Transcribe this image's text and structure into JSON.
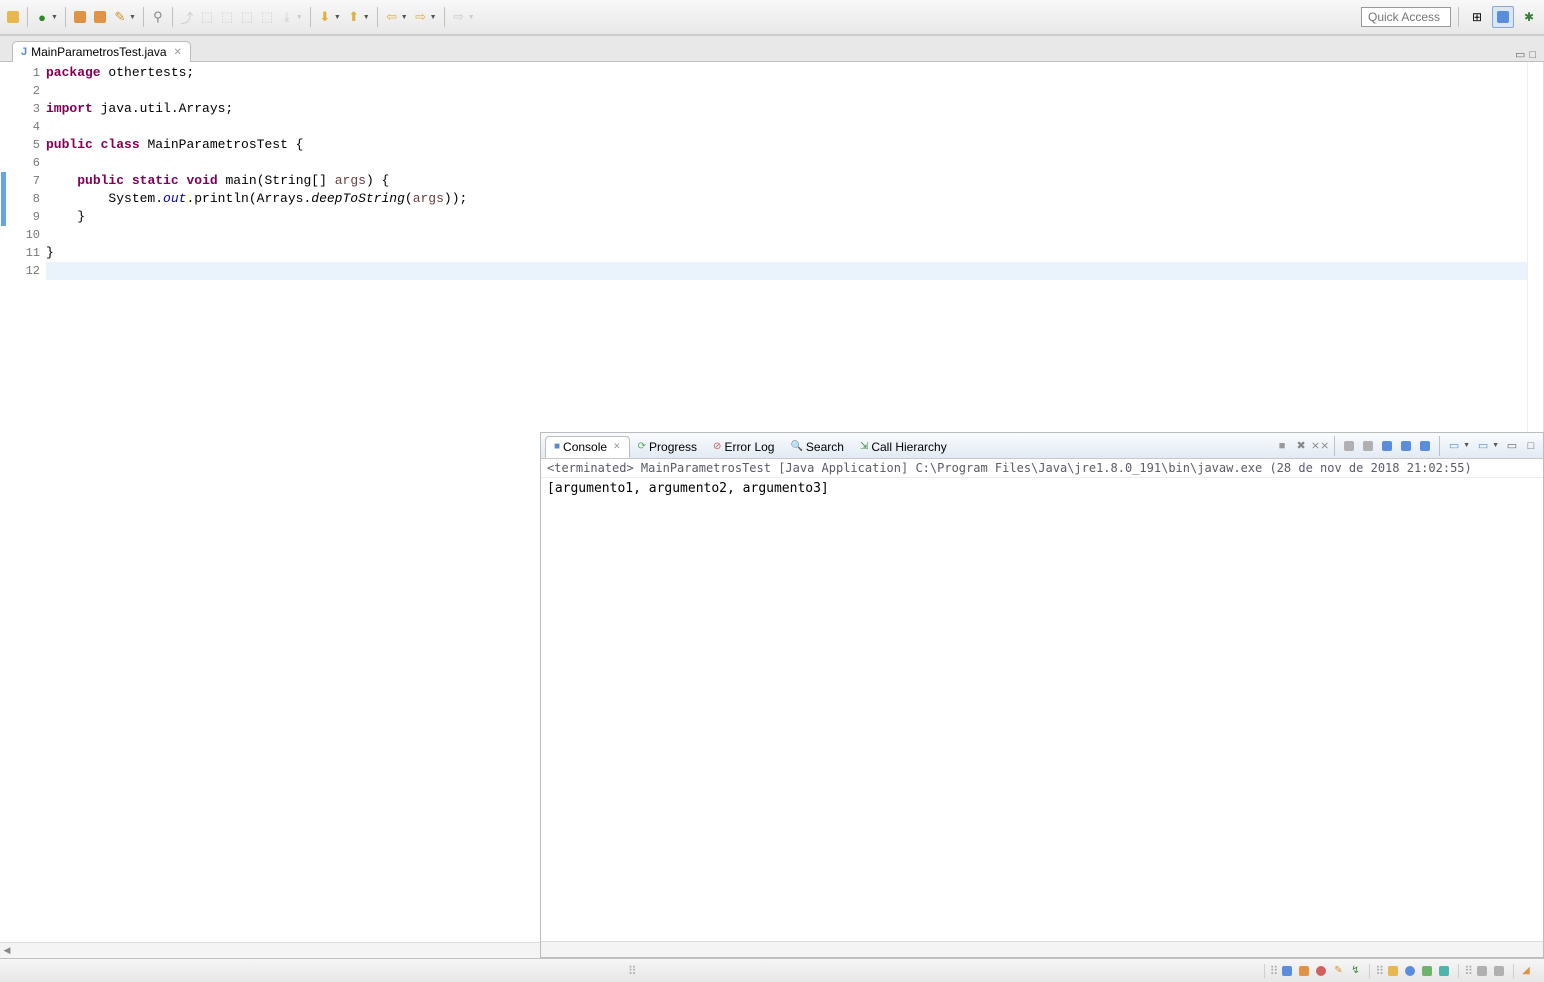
{
  "toolbar": {
    "quick_access_placeholder": "Quick Access"
  },
  "editor": {
    "tab_filename": "MainParametrosTest.java",
    "code_lines": [
      {
        "n": 1,
        "seg": [
          [
            "kw",
            "package"
          ],
          [
            "txt",
            " othertests;"
          ]
        ]
      },
      {
        "n": 2,
        "seg": [
          [
            "txt",
            ""
          ]
        ]
      },
      {
        "n": 3,
        "seg": [
          [
            "kw",
            "import"
          ],
          [
            "txt",
            " java.util.Arrays;"
          ]
        ]
      },
      {
        "n": 4,
        "seg": [
          [
            "txt",
            ""
          ]
        ]
      },
      {
        "n": 5,
        "seg": [
          [
            "kw",
            "public"
          ],
          [
            "txt",
            " "
          ],
          [
            "kw",
            "class"
          ],
          [
            "txt",
            " MainParametrosTest {"
          ]
        ]
      },
      {
        "n": 6,
        "seg": [
          [
            "txt",
            ""
          ]
        ]
      },
      {
        "n": 7,
        "seg": [
          [
            "txt",
            "    "
          ],
          [
            "kw",
            "public"
          ],
          [
            "txt",
            " "
          ],
          [
            "kw",
            "static"
          ],
          [
            "txt",
            " "
          ],
          [
            "kw",
            "void"
          ],
          [
            "txt",
            " main(String[] "
          ],
          [
            "param",
            "args"
          ],
          [
            "txt",
            ") {"
          ]
        ],
        "mark": "override"
      },
      {
        "n": 8,
        "seg": [
          [
            "txt",
            "        System."
          ],
          [
            "field-static",
            "out"
          ],
          [
            "txt",
            ".println(Arrays."
          ],
          [
            "method-italic",
            "deepToString"
          ],
          [
            "txt",
            "("
          ],
          [
            "param",
            "args"
          ],
          [
            "txt",
            "));"
          ]
        ]
      },
      {
        "n": 9,
        "seg": [
          [
            "txt",
            "    }"
          ]
        ]
      },
      {
        "n": 10,
        "seg": [
          [
            "txt",
            ""
          ]
        ]
      },
      {
        "n": 11,
        "seg": [
          [
            "txt",
            "}"
          ]
        ]
      },
      {
        "n": 12,
        "seg": [
          [
            "txt",
            ""
          ]
        ],
        "current": true
      }
    ],
    "method_highlight_range": [
      7,
      9
    ]
  },
  "console": {
    "tabs": [
      {
        "label": "Console",
        "icon": "■",
        "active": true
      },
      {
        "label": "Progress",
        "icon": "⟳"
      },
      {
        "label": "Error Log",
        "icon": "⊘"
      },
      {
        "label": "Search",
        "icon": "🔍"
      },
      {
        "label": "Call Hierarchy",
        "icon": "⇲"
      }
    ],
    "status": "<terminated> MainParametrosTest [Java Application] C:\\Program Files\\Java\\jre1.8.0_191\\bin\\javaw.exe (28 de nov de 2018 21:02:55)",
    "output": "[argumento1, argumento2, argumento3]"
  }
}
